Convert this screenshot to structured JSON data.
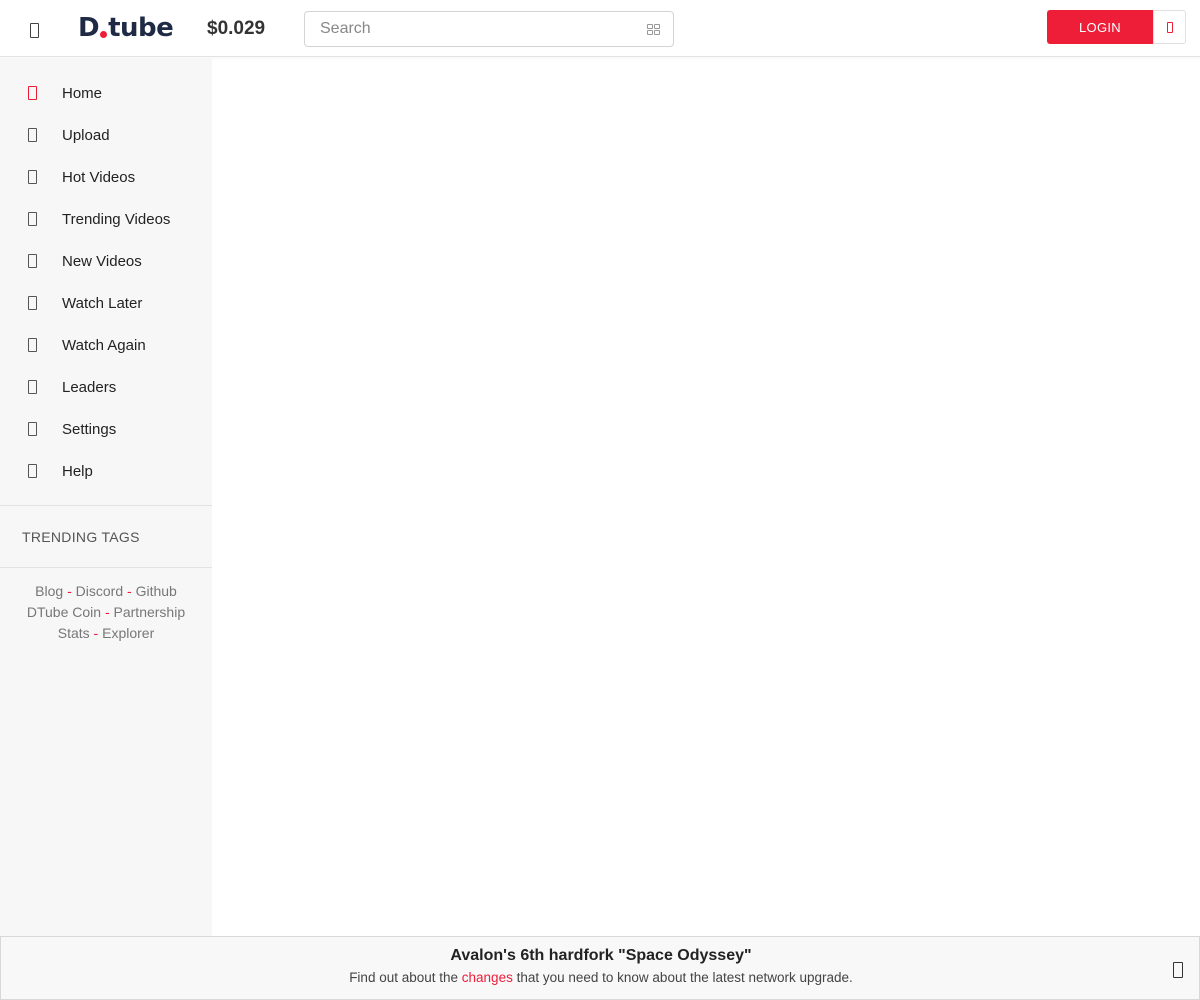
{
  "header": {
    "logo_text": "tube",
    "logo_letter": "D",
    "price": "$0.029",
    "search_placeholder": "Search",
    "login_label": "LOGIN"
  },
  "sidebar": {
    "items": [
      {
        "label": "Home",
        "icon": "home-icon",
        "active": true
      },
      {
        "label": "Upload",
        "icon": "upload-icon"
      },
      {
        "label": "Hot Videos",
        "icon": "fire-icon"
      },
      {
        "label": "Trending Videos",
        "icon": "trending-icon"
      },
      {
        "label": "New Videos",
        "icon": "new-icon"
      },
      {
        "label": "Watch Later",
        "icon": "clock-icon"
      },
      {
        "label": "Watch Again",
        "icon": "history-icon"
      },
      {
        "label": "Leaders",
        "icon": "trophy-icon"
      },
      {
        "label": "Settings",
        "icon": "gear-icon"
      },
      {
        "label": "Help",
        "icon": "help-icon"
      }
    ],
    "trending_tags_label": "TRENDING TAGS",
    "footer_links": {
      "blog": "Blog",
      "discord": "Discord",
      "github": "Github",
      "dtube_coin": "DTube Coin",
      "partnership": "Partnership",
      "stats": "Stats",
      "explorer": "Explorer",
      "separator": "-"
    }
  },
  "notice": {
    "title": "Avalon's 6th hardfork \"Space Odyssey\"",
    "body_before": "Find out about the ",
    "body_link": "changes",
    "body_after": " that you need to know about the latest network upgrade."
  },
  "colors": {
    "accent": "#ee1d38",
    "sidebar_bg": "#f7f7f7"
  }
}
